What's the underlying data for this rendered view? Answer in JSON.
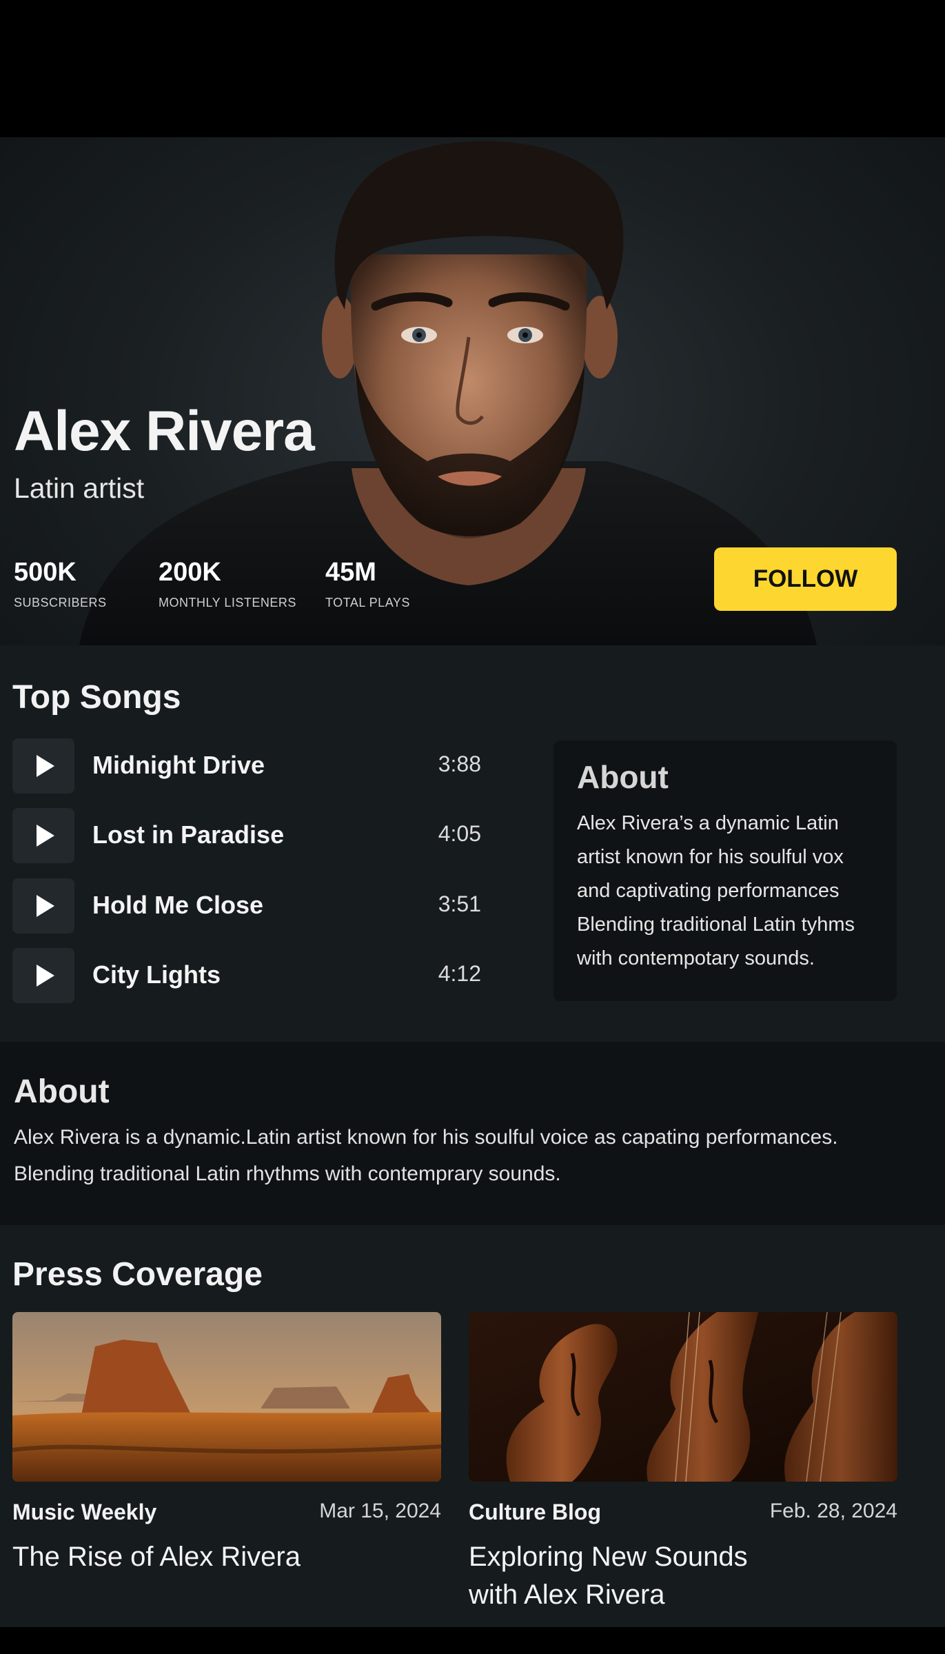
{
  "artist": {
    "name": "Alex Rivera",
    "genre": "Latin artist",
    "follow_label": "FOLLOW"
  },
  "stats": [
    {
      "value": "500K",
      "label": "SUBSCRIBERS"
    },
    {
      "value": "200K",
      "label": "MONTHLY LISTENERS"
    },
    {
      "value": "45M",
      "label": "TOTAL PLAYS"
    }
  ],
  "top_songs": {
    "title": "Top Songs",
    "songs": [
      {
        "title": "Midnight Drive",
        "duration": "3:88"
      },
      {
        "title": "Lost in Paradise",
        "duration": "4:05"
      },
      {
        "title": "Hold Me Close",
        "duration": "3:51"
      },
      {
        "title": "City Lights",
        "duration": "4:12"
      }
    ]
  },
  "about_card": {
    "title": "About",
    "text": "Alex Rivera’s a dynamic Latin artist known for his soulful vox and captivating performances Blending traditional Latin tyhms with contempotary sounds."
  },
  "about_band": {
    "title": "About",
    "text": "Alex Rivera is a dynamic.Latin artist known for his soulful voice as capating performances. Blending traditional Latin rhythms with contemprary sounds."
  },
  "press": {
    "title": "Press Coverage",
    "articles": [
      {
        "source": "Music Weekly",
        "date": "Mar 15, 2024",
        "headline": "The Rise of Alex Rivera",
        "image": "desert-mesa-landscape"
      },
      {
        "source": "Culture Blog",
        "date": "Feb. 28, 2024",
        "headline": "Exploring New Sounds with Alex Rivera",
        "image": "violins-closeup"
      }
    ]
  },
  "colors": {
    "accent": "#fdd730",
    "background": "#161b1e",
    "card": "#101315"
  }
}
